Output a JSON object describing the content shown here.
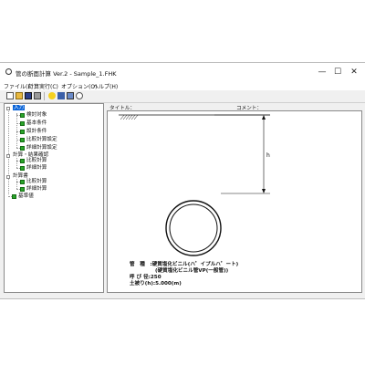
{
  "window": {
    "title": "管の断面計算 Ver.2 - Sample_1.FHK",
    "minimize": "—",
    "maximize": "☐",
    "close": "✕"
  },
  "menu": [
    "ファイル(F)",
    "計算実行(C)",
    "オプション(O)",
    "ヘルプ(H)"
  ],
  "toolbar_icons": [
    "new-file-icon",
    "open-folder-icon",
    "save-icon",
    "print-icon",
    "help-icon",
    "calc-icon",
    "preview-icon",
    "circle-icon"
  ],
  "tree": {
    "root": "入力",
    "input_items": [
      "検討対象",
      "基本条件",
      "設計条件",
      "比較計算設定",
      "詳細計算設定"
    ],
    "results": "計算・結果確認",
    "results_items": [
      "比較計算",
      "詳細計算"
    ],
    "report": "計算書",
    "report_items": [
      "比較計算",
      "詳細計算"
    ],
    "standards": "基準値"
  },
  "header": {
    "title_label": "タイトル：",
    "comment_label": "コメント："
  },
  "drawing": {
    "depth_symbol": "h",
    "pipe_label": "管　種　:硬質塩化ビニル(ハ゜イプルハ゜ート)",
    "pipe_label_2": "(硬質塩化ビニル管VP(一般管))",
    "diameter": "呼 び 径:250",
    "cover": "土被り(h):5.000(m)"
  },
  "colors": {
    "check": "#2aa52a",
    "selection": "#0a64d8",
    "frame": "#8a8a8a"
  }
}
